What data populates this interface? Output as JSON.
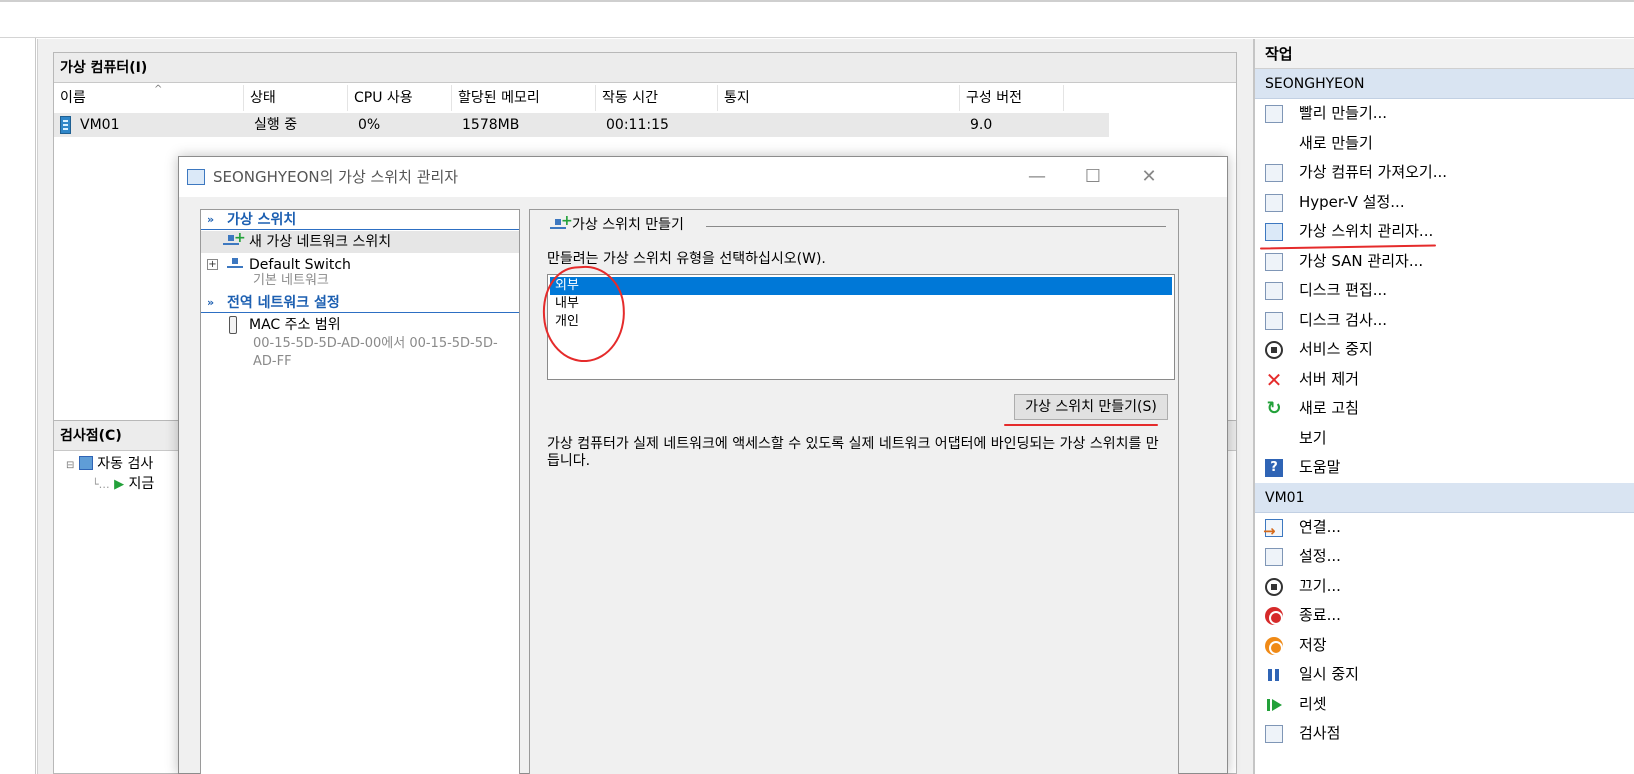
{
  "vm_panel": {
    "title": "가상 컴퓨터(I)",
    "columns": [
      "이름",
      "상태",
      "CPU 사용",
      "할당된 메모리",
      "작동 시간",
      "통지",
      "구성 버전"
    ],
    "sort_indicator": "^",
    "rows": [
      {
        "name": "VM01",
        "status": "실행 중",
        "cpu": "0%",
        "memory": "1578MB",
        "uptime": "00:11:15",
        "notice": "",
        "version": "9.0"
      }
    ]
  },
  "checkpoint_panel": {
    "title": "검사점(C)",
    "items": [
      "자동 검사",
      "지금"
    ]
  },
  "actions_panel": {
    "title": "작업",
    "sections": [
      {
        "name": "SEONGHYEON",
        "items": [
          {
            "label": "빨리 만들기...",
            "icon": "quick-create-icon"
          },
          {
            "label": "새로 만들기",
            "icon": ""
          },
          {
            "label": "가상 컴퓨터 가져오기...",
            "icon": "import-vm-icon"
          },
          {
            "label": "Hyper-V 설정...",
            "icon": "hyperv-settings-icon"
          },
          {
            "label": "가상 스위치 관리자...",
            "icon": "virtual-switch-icon"
          },
          {
            "label": "가상 SAN 관리자...",
            "icon": "virtual-san-icon"
          },
          {
            "label": "디스크 편집...",
            "icon": "edit-disk-icon"
          },
          {
            "label": "디스크 검사...",
            "icon": "inspect-disk-icon"
          },
          {
            "label": "서비스 중지",
            "icon": "stop-service-icon"
          },
          {
            "label": "서버 제거",
            "icon": "remove-server-icon"
          },
          {
            "label": "새로 고침",
            "icon": "refresh-icon"
          },
          {
            "label": "보기",
            "icon": ""
          },
          {
            "label": "도움말",
            "icon": "help-icon"
          }
        ]
      },
      {
        "name": "VM01",
        "items": [
          {
            "label": "연결...",
            "icon": "connect-icon"
          },
          {
            "label": "설정...",
            "icon": "settings-icon"
          },
          {
            "label": "끄기...",
            "icon": "turn-off-icon"
          },
          {
            "label": "종료...",
            "icon": "shutdown-icon"
          },
          {
            "label": "저장",
            "icon": "save-icon"
          },
          {
            "label": "일시 중지",
            "icon": "pause-icon"
          },
          {
            "label": "리셋",
            "icon": "reset-icon"
          },
          {
            "label": "검사점",
            "icon": "checkpoint-icon"
          }
        ]
      }
    ]
  },
  "dialog": {
    "title": "SEONGHYEON의 가상 스위치 관리자",
    "window_buttons": {
      "minimize": "—",
      "maximize": "☐",
      "close": "✕"
    },
    "nav": {
      "section1": "가상 스위치",
      "new_switch": "새 가상 네트워크 스위치",
      "default_switch": "Default Switch",
      "default_switch_sub": "기본 네트워크",
      "section2": "전역 네트워크 설정",
      "mac_range": "MAC 주소 범위",
      "mac_range_value": "00-15-5D-5D-AD-00에서 00-15-5D-5D-AD-FF",
      "expander": "+",
      "chevron": "»"
    },
    "content": {
      "group_title": "가상 스위치 만들기",
      "prompt": "만들려는 가상 스위치 유형을 선택하십시오(W).",
      "types": [
        "외부",
        "내부",
        "개인"
      ],
      "selected_type": "외부",
      "create_button": "가상 스위치 만들기(S)",
      "description": "가상 컴퓨터가 실제 네트워크에 액세스할 수 있도록 실제 네트워크 어댑터에 바인딩되는 가상 스위치를 만듭니다."
    }
  },
  "colors": {
    "annotation_red": "#e52b2b",
    "selection_blue": "#0078d7",
    "section_blue": "#d9e4f2",
    "link_blue": "#1c5fb1"
  }
}
